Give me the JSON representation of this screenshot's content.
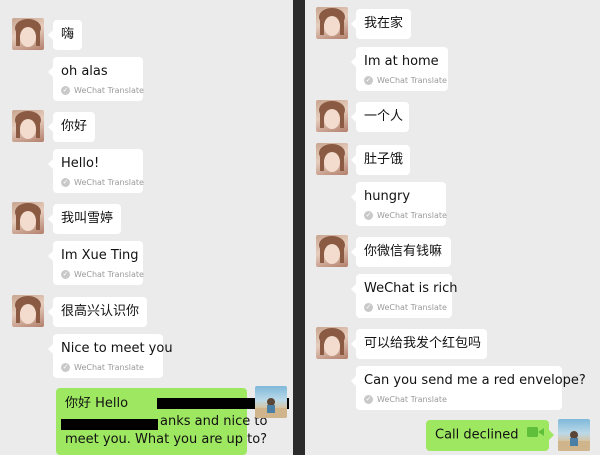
{
  "left_chat": {
    "messages": [
      {
        "text": "嗨"
      },
      {
        "text": "oh alas",
        "translation": "WeChat Translate"
      },
      {
        "text": "你好"
      },
      {
        "text": "Hello!",
        "translation": "WeChat Translate"
      },
      {
        "text": "我叫雪婷"
      },
      {
        "text": "Im Xue Ting",
        "translation": "WeChat Translate"
      },
      {
        "text": "很高兴认识你"
      },
      {
        "text": "Nice to meet you",
        "translation": "WeChat Translate"
      }
    ],
    "outgoing": {
      "line1": "你好 Hello",
      "line2": "anks and nice to",
      "line3": "meet you. What you are up to?"
    }
  },
  "right_chat": {
    "messages": [
      {
        "text": "我在家"
      },
      {
        "text": "Im at home",
        "translation": "WeChat Translate"
      },
      {
        "text": "一个人"
      },
      {
        "text": "肚子饿"
      },
      {
        "text": "hungry",
        "translation": "WeChat Translate"
      },
      {
        "text": "你微信有钱嘛"
      },
      {
        "text": "WeChat is rich",
        "translation": "WeChat Translate"
      },
      {
        "text": "可以给我发个红包吗"
      },
      {
        "text": "Can you send me a red envelope?",
        "translation": "WeChat Translate"
      }
    ],
    "outgoing": {
      "call_status": "Call declined"
    }
  },
  "icons": {
    "check": "✓",
    "video": "video-camera-icon"
  },
  "colors": {
    "chat_background": "#ebebeb",
    "incoming_bubble": "#ffffff",
    "outgoing_bubble": "#9ee861",
    "translate_text": "#9a9a9a"
  }
}
